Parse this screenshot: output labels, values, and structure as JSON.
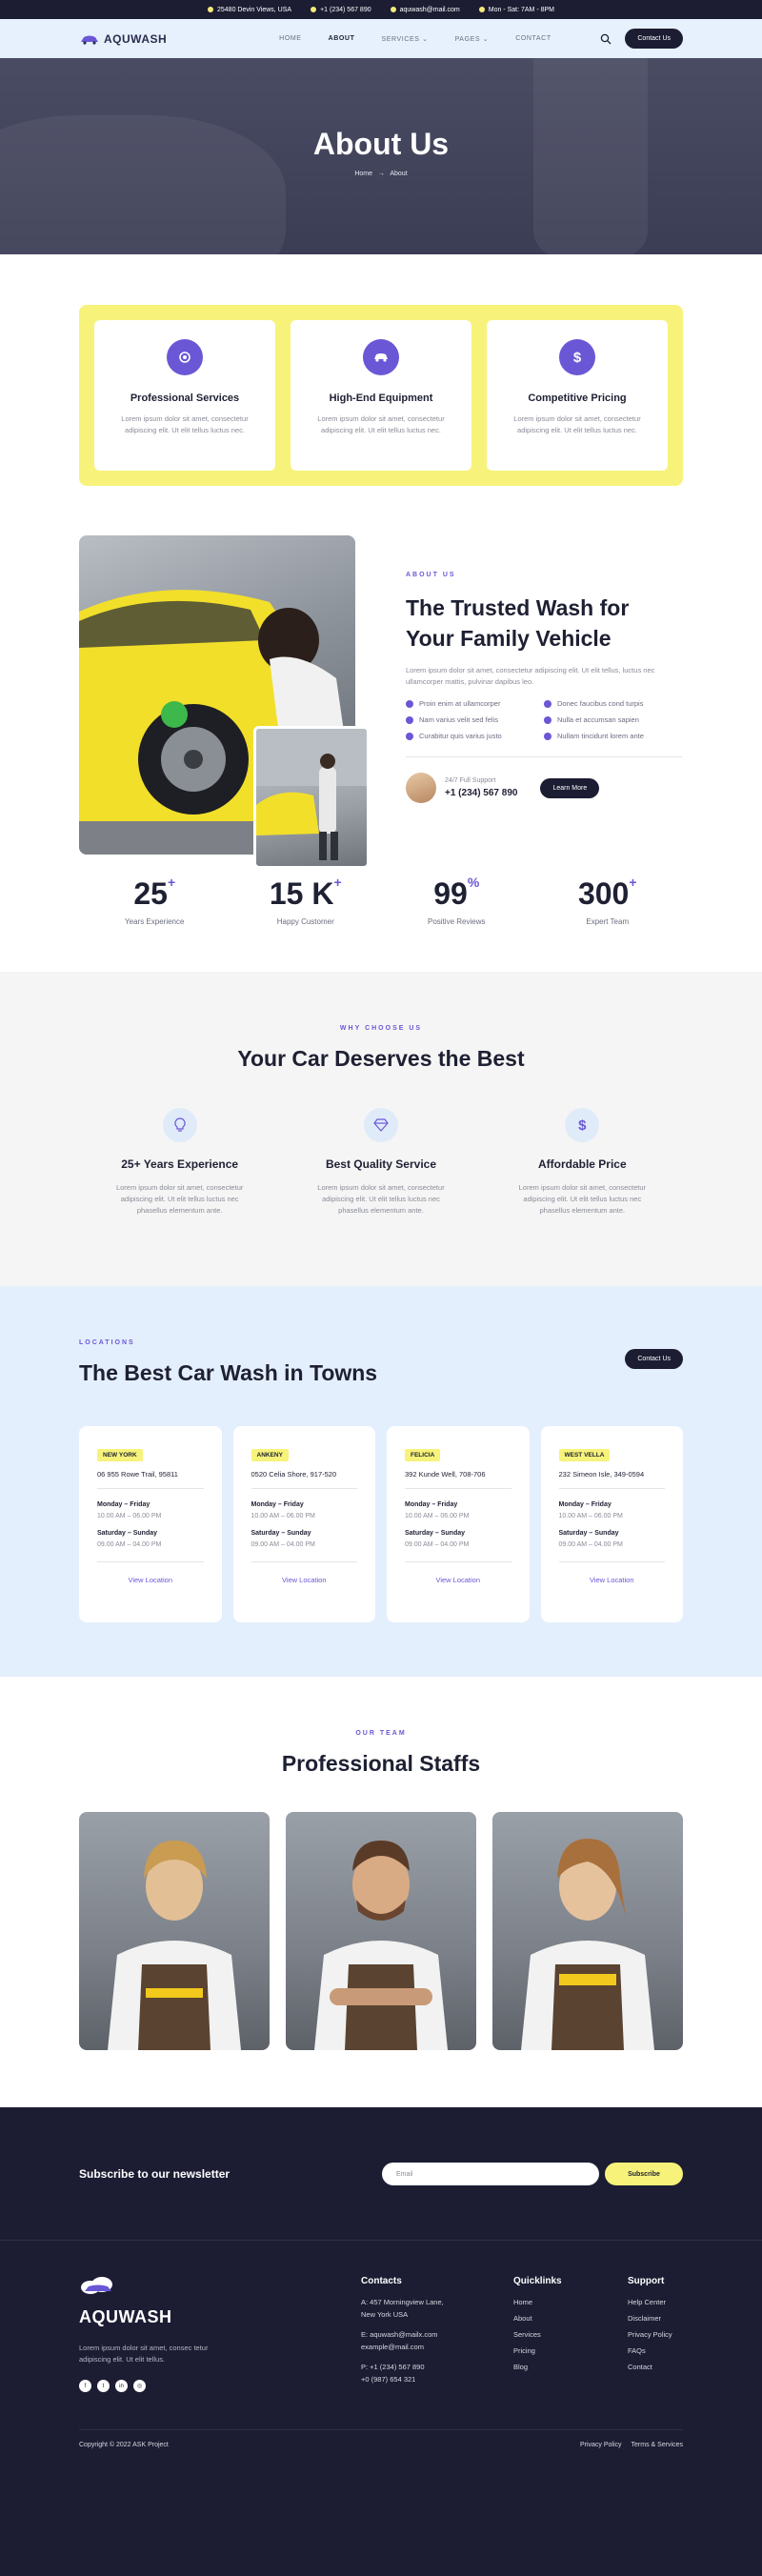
{
  "topbar": {
    "address": "25480 Devin Views, USA",
    "phone": "+1 (234) 567 890",
    "email": "aquwash@mail.com",
    "hours": "Mon - Sat: 7AM - 8PM"
  },
  "nav": {
    "logo": "AQUWASH",
    "items": [
      "HOME",
      "ABOUT",
      "SERVICES",
      "PAGES",
      "CONTACT"
    ],
    "contact_button": "Contact Us"
  },
  "hero": {
    "title": "About Us",
    "breadcrumb_home": "Home",
    "breadcrumb_sep": "→",
    "breadcrumb_current": "About"
  },
  "features": [
    {
      "icon": "gear-icon",
      "title": "Professional Services",
      "text": "Lorem ipsum dolor sit amet, consectetur adipiscing elit. Ut elit tellus luctus nec."
    },
    {
      "icon": "car-icon",
      "title": "High-End Equipment",
      "text": "Lorem ipsum dolor sit amet, consectetur adipiscing elit. Ut elit tellus luctus nec."
    },
    {
      "icon": "dollar-icon",
      "title": "Competitive Pricing",
      "text": "Lorem ipsum dolor sit amet, consectetur adipiscing elit. Ut elit tellus luctus nec."
    }
  ],
  "about": {
    "eyebrow": "ABOUT US",
    "title_line1": "The Trusted Wash for",
    "title_line2": "Your Family Vehicle",
    "lead": "Lorem ipsum dolor sit amet, consectetur adipiscing elit. Ut elit tellus, luctus nec ullamcorper mattis, pulvinar dapibus leo.",
    "checks": [
      "Proin enim at ullamcorper",
      "Donec faucibus cond turpis",
      "Nam varius velit sed felis",
      "Nulla et accumsan sapien",
      "Curabitur quis varius justo",
      "Nullam tincidunt lorem ante"
    ],
    "support_label": "24/7 Full Support",
    "support_phone": "+1 (234) 567 890",
    "learn_more": "Learn More"
  },
  "stats": [
    {
      "value": "25",
      "suffix": "+",
      "label": "Years Experience"
    },
    {
      "value": "15 K",
      "suffix": "+",
      "label": "Happy Customer"
    },
    {
      "value": "99",
      "suffix": "%",
      "label": "Positive Reviews"
    },
    {
      "value": "300",
      "suffix": "+",
      "label": "Expert Team"
    }
  ],
  "why": {
    "eyebrow": "WHY CHOOSE US",
    "title": "Your Car Deserves the Best",
    "items": [
      {
        "icon": "lightbulb-icon",
        "title": "25+ Years Experience",
        "text": "Lorem ipsum dolor sit amet, consectetur adipiscing elit. Ut elit tellus luctus nec phasellus elementum ante."
      },
      {
        "icon": "diamond-icon",
        "title": "Best Quality Service",
        "text": "Lorem ipsum dolor sit amet, consectetur adipiscing elit. Ut elit tellus luctus nec phasellus elementum ante."
      },
      {
        "icon": "dollar-icon",
        "title": "Affordable Price",
        "text": "Lorem ipsum dolor sit amet, consectetur adipiscing elit. Ut elit tellus luctus nec phasellus elementum ante."
      }
    ]
  },
  "locations": {
    "eyebrow": "LOCATIONS",
    "title": "The Best Car Wash in Towns",
    "contact_button": "Contact Us",
    "cards": [
      {
        "tag": "NEW YORK",
        "address": "06 955 Rowe Trail, 95811",
        "day1": "Monday – Friday",
        "time1": "10.00 AM – 06.00 PM",
        "day2": "Saturday – Sunday",
        "time2": "09.00 AM – 04.00 PM",
        "link": "View Location"
      },
      {
        "tag": "ANKENY",
        "address": "0520 Celia Shore, 917-520",
        "day1": "Monday – Friday",
        "time1": "10.00 AM – 06.00 PM",
        "day2": "Saturday – Sunday",
        "time2": "09.00 AM – 04.00 PM",
        "link": "View Location"
      },
      {
        "tag": "FELICIA",
        "address": "392 Kunde Well, 708-706",
        "day1": "Monday – Friday",
        "time1": "10.00 AM – 06.00 PM",
        "day2": "Saturday – Sunday",
        "time2": "09.00 AM – 04.00 PM",
        "link": "View Location"
      },
      {
        "tag": "WEST VELLA",
        "address": "232 Simeon Isle, 349-0594",
        "day1": "Monday – Friday",
        "time1": "10.00 AM – 06.00 PM",
        "day2": "Saturday – Sunday",
        "time2": "09.00 AM – 04.00 PM",
        "link": "View Location"
      }
    ]
  },
  "team": {
    "eyebrow": "OUR TEAM",
    "title": "Professional Staffs"
  },
  "newsletter": {
    "title": "Subscribe to our newsletter",
    "placeholder": "Email",
    "button": "Subscribe"
  },
  "footer": {
    "logo": "AQUWASH",
    "about": "Lorem ipsum dolor sit amet, consec tetur adipiscing elit. Ut elit tellus.",
    "contacts_title": "Contacts",
    "address_1": "A: 457 Morningview Lane,",
    "address_2": "New York USA",
    "email_1": "E: aquwash@mailx.com",
    "email_2": "example@mail.com",
    "phone_1": "P: +1 (234) 567 890",
    "phone_2": "+0 (987) 654 321",
    "quicklinks_title": "Quicklinks",
    "quicklinks": [
      "Home",
      "About",
      "Services",
      "Pricing",
      "Blog"
    ],
    "support_title": "Support",
    "support_links": [
      "Help Center",
      "Disclaimer",
      "Privacy Policy",
      "FAQs",
      "Contact"
    ],
    "copyright": "Copyright © 2022 ASK Project",
    "privacy": "Privacy Policy",
    "terms": "Terms & Services"
  }
}
